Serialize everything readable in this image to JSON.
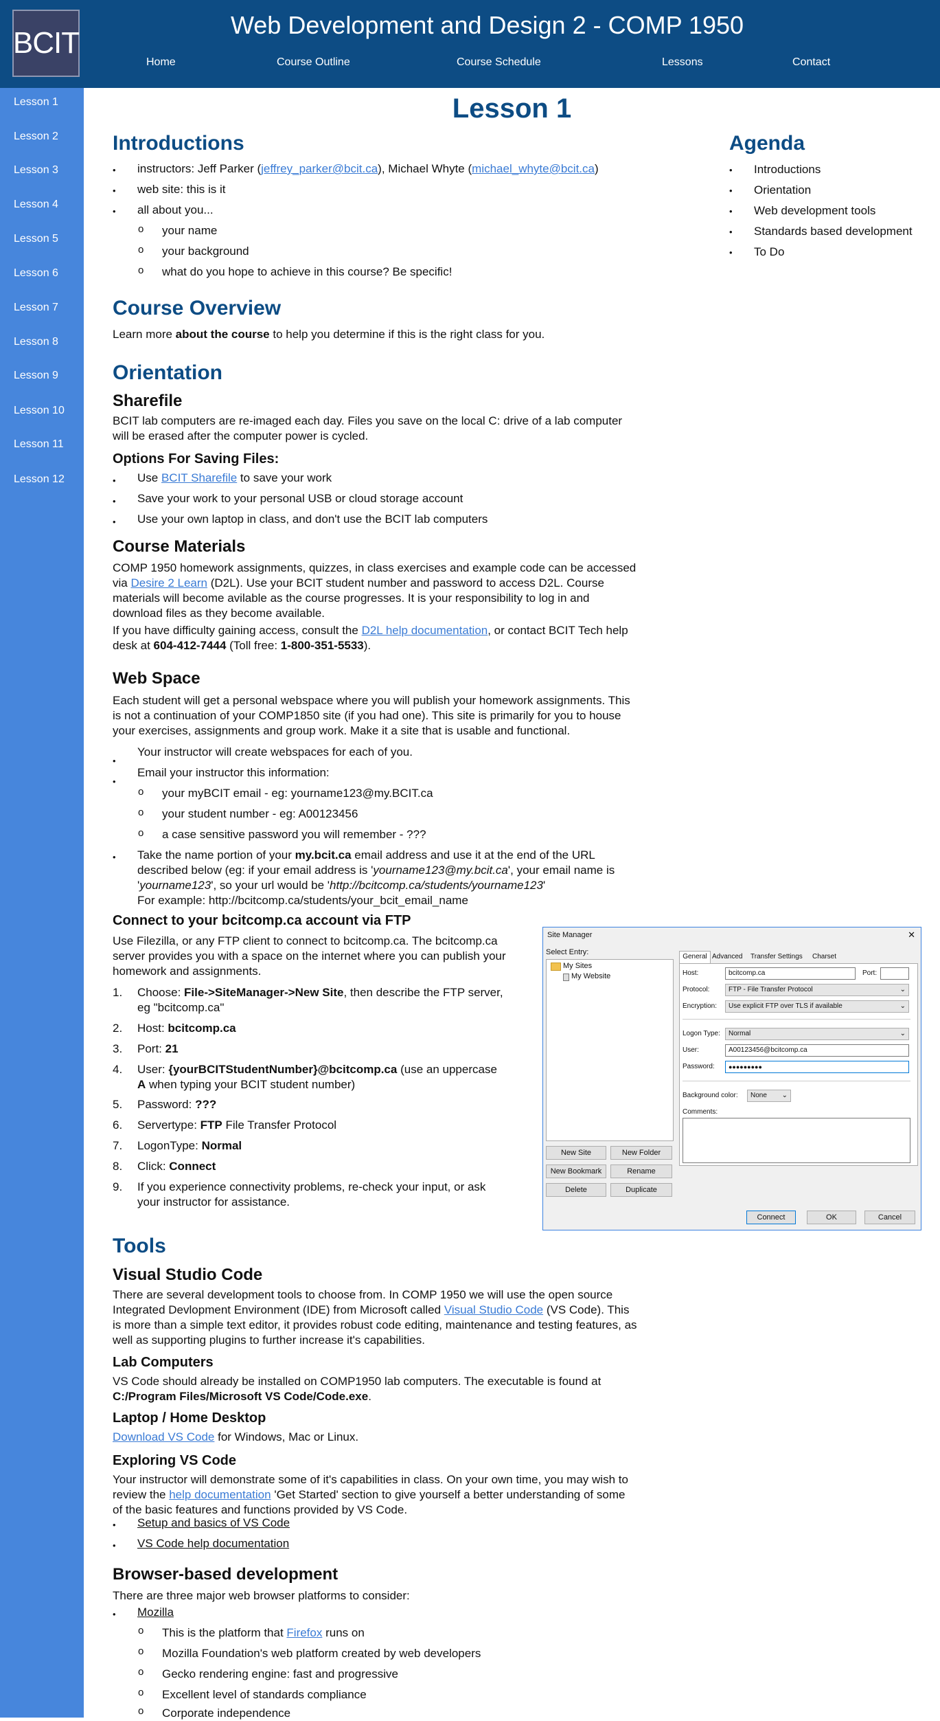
{
  "header": {
    "logo": "BCIT",
    "title": "Web Development and Design 2 - COMP 1950",
    "nav": [
      "Home",
      "Course Outline",
      "Course Schedule",
      "Lessons",
      "Contact"
    ]
  },
  "sidebar": {
    "items": [
      "Lesson 1",
      "Lesson 2",
      "Lesson 3",
      "Lesson 4",
      "Lesson 5",
      "Lesson 6",
      "Lesson 7",
      "Lesson 8",
      "Lesson 9",
      "Lesson 10",
      "Lesson 11",
      "Lesson 12"
    ]
  },
  "page_title": "Lesson 1",
  "agenda": {
    "title": "Agenda",
    "items": [
      "Introductions",
      "Orientation",
      "Web development tools",
      "Standards based development",
      "To Do"
    ]
  },
  "introductions": {
    "title": "Introductions",
    "instructors_prefix": "instructors: Jeff Parker (",
    "email1": "jeffrey_parker@bcit.ca",
    "instructors_mid": "), Michael Whyte (",
    "email2": "michael_whyte@bcit.ca",
    "instructors_suffix": ")",
    "website": "web site: this is it",
    "about": "all about you...",
    "sub": [
      "your name",
      "your background",
      "what do you hope to achieve in this course? Be specific!"
    ]
  },
  "course_overview": {
    "title": "Course Overview",
    "text_pre": "Learn more ",
    "text_bold": "about the course",
    "text_post": " to help you determine if this is the right class for you."
  },
  "orientation": {
    "title": "Orientation",
    "sharefile_title": "Sharefile",
    "sharefile_text_1": "BCIT lab computers are re-imaged each day. Files you save on the local C: drive of a lab computer",
    "sharefile_text_2": "will be erased after the computer power is cycled.",
    "options_title": "Options For Saving Files:",
    "opt1_pre": "Use ",
    "opt1_link": "BCIT Sharefile",
    "opt1_post": " to save your work",
    "opt2": "Save your work to your personal USB or cloud storage account",
    "opt3": "Use your own laptop in class, and don't use the BCIT lab computers"
  },
  "materials": {
    "title": "Course Materials",
    "line1": "COMP 1950 homework assignments, quizzes, in class exercises and example code can be accessed",
    "line2_pre": "via ",
    "line2_link": "Desire 2 Learn",
    "line2_post": " (D2L). Use your BCIT student number and password to access D2L. Course",
    "line3": "materials will become avilable as the course progresses. It is your responsibility to log in and",
    "line4": "download files as they become available.",
    "line5_pre": "If you have difficulty gaining access, consult the ",
    "line5_link": "D2L help documentation",
    "line5_post": ", or contact BCIT Tech help",
    "line6_pre": "desk at ",
    "phone": "604-412-7444",
    "line6_mid": " (Toll free: ",
    "tollfree": "1-800-351-5533",
    "line6_post": ")."
  },
  "webspace": {
    "title": "Web Space",
    "p1": "Each student will get a personal webspace where you will publish your homework assignments. This",
    "p2": "is not a continuation of your COMP1850 site (if you had one). This site is primarily for you to house",
    "p3": "your exercises, assignments and group work. Make it a site that is usable and functional.",
    "b1": "Your instructor will create webspaces for each of you.",
    "b2": "Email your instructor this information:",
    "sub": [
      "your myBCIT email - eg: yourname123@my.BCIT.ca",
      "your student number - eg: A00123456",
      "a case sensitive password you will remember - ???"
    ],
    "b3_l1_pre": "Take the name portion of your ",
    "b3_l1_bold": "my.bcit.ca",
    "b3_l1_post": " email address and use it at the end of the URL",
    "b3_l2_pre": "described below (eg: if your email address is '",
    "b3_l2_ital": "yourname123@my.bcit.ca",
    "b3_l2_post": "', your email name is",
    "b3_l3_pre": "'",
    "b3_l3_ital1": "yourname123",
    "b3_l3_mid": "', so your url would be '",
    "b3_l3_ital2": "http://bcitcomp.ca/students/yourname123",
    "b3_l3_post": "'",
    "b3_l4": "For example: http://bcitcomp.ca/students/your_bcit_email_name"
  },
  "ftp": {
    "title": "Connect to your bcitcomp.ca account via FTP",
    "p1": "Use Filezilla, or any FTP client to connect to bcitcomp.ca. The bcitcomp.ca",
    "p2": "server provides you with a space on the internet where you can publish your",
    "p3": "homework and assignments.",
    "s1_pre": "Choose: ",
    "s1_bold": "File->SiteManager->New Site",
    "s1_post": ", then describe the FTP server,",
    "s1_l2": "eg \"bcitcomp.ca\"",
    "s2_pre": "Host: ",
    "s2_bold": "bcitcomp.ca",
    "s3_pre": "Port: ",
    "s3_bold": "21",
    "s4_pre": "User: ",
    "s4_bold": "{yourBCITStudentNumber}@bcitcomp.ca",
    "s4_post": " (use an uppercase",
    "s4_l2_bold": "A",
    "s4_l2_post": " when typing your BCIT student number)",
    "s5_pre": "Password: ",
    "s5_bold": "???",
    "s6_pre": "Servertype: ",
    "s6_bold": "FTP",
    "s6_post": " File Transfer Protocol",
    "s7_pre": "LogonType: ",
    "s7_bold": "Normal",
    "s8_pre": "Click: ",
    "s8_bold": "Connect",
    "s9_l1": "If you experience connectivity problems, re-check your input, or ask",
    "s9_l2": "your instructor for assistance.",
    "nums": [
      "1.",
      "2.",
      "3.",
      "4.",
      "5.",
      "6.",
      "7.",
      "8.",
      "9."
    ]
  },
  "site_manager": {
    "title": "Site Manager",
    "select_entry": "Select Entry:",
    "tree_root": "My Sites",
    "tree_child": "My Website",
    "tabs": [
      "General",
      "Advanced",
      "Transfer Settings",
      "Charset"
    ],
    "host_label": "Host:",
    "host_value": "bcitcomp.ca",
    "port_label": "Port:",
    "protocol_label": "Protocol:",
    "protocol_value": "FTP - File Transfer Protocol",
    "encryption_label": "Encryption:",
    "encryption_value": "Use explicit FTP over TLS if available",
    "logon_label": "Logon Type:",
    "logon_value": "Normal",
    "user_label": "User:",
    "user_value": "A00123456@bcitcomp.ca",
    "password_label": "Password:",
    "password_value": "●●●●●●●●●",
    "bg_label": "Background color:",
    "bg_value": "None",
    "comments_label": "Comments:",
    "buttons": [
      "New Site",
      "New Folder",
      "New Bookmark",
      "Rename",
      "Delete",
      "Duplicate"
    ],
    "connect": "Connect",
    "ok": "OK",
    "cancel": "Cancel",
    "close": "✕"
  },
  "tools": {
    "title": "Tools",
    "vsc_title": "Visual Studio Code",
    "vsc_l1": "There are several development tools to choose from. In COMP 1950 we will use the open source",
    "vsc_l2_pre": "Integrated Devlopment Environment (IDE) from Microsoft called ",
    "vsc_l2_link": "Visual Studio Code",
    "vsc_l2_post": " (VS Code). This",
    "vsc_l3": "is more than a simple text editor, it provides robust code editing, maintenance and testing features, as",
    "vsc_l4": "well as supporting plugins to further increase it's capabilities.",
    "lab_title": "Lab Computers",
    "lab_l1": "VS Code should already be installed on COMP1950 lab computers. The executable is found at",
    "lab_l2": "C:/Program Files/Microsoft VS Code/Code.exe",
    "lab_l2_post": ".",
    "laptop_title": "Laptop / Home Desktop",
    "laptop_link": "Download VS Code",
    "laptop_post": " for Windows, Mac or Linux.",
    "explore_title": "Exploring VS Code",
    "explore_l1": "Your instructor will demonstrate some of it's capabilities in class. On your own time, you may wish to",
    "explore_l2_pre": "review the ",
    "explore_l2_link": "help documentation",
    "explore_l2_post": " 'Get Started' section to give yourself a better understanding of some",
    "explore_l3": "of the basic features and functions provided by VS Code.",
    "explore_links": [
      "Setup and basics of VS Code",
      "VS Code help documentation"
    ]
  },
  "browser": {
    "title": "Browser-based development",
    "intro": "There are three major web browser platforms to consider:",
    "mozilla": "Mozilla",
    "sub1_pre": "This is the platform that ",
    "sub1_link": "Firefox",
    "sub1_post": " runs on",
    "subs": [
      "Mozilla Foundation's web platform created by web developers",
      "Gecko rendering engine: fast and progressive",
      "Excellent level of standards compliance",
      "Corporate independence"
    ]
  },
  "glyphs": {
    "bullet": "•",
    "circle": "o"
  }
}
